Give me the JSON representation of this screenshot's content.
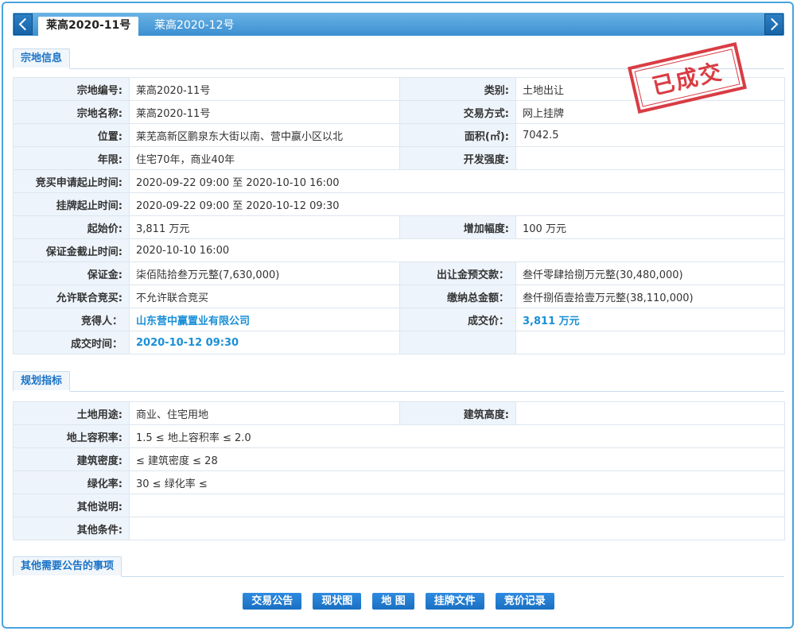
{
  "tabs": {
    "active": "莱高2020-11号",
    "inactive": "莱高2020-12号",
    "prev_icon": "chevron-left-icon",
    "next_icon": "chevron-right-icon"
  },
  "sections": {
    "parcel": "宗地信息",
    "planning": "规划指标",
    "other": "其他需要公告的事项"
  },
  "stamp": "已成交",
  "parcel": {
    "rows": [
      {
        "k1": "宗地编号:",
        "v1": "莱高2020-11号",
        "k2": "类别:",
        "v2": "土地出让"
      },
      {
        "k1": "宗地名称:",
        "v1": "莱高2020-11号",
        "k2": "交易方式:",
        "v2": "网上挂牌"
      },
      {
        "k1": "位置:",
        "v1": "莱芜高新区鹏泉东大街以南、营中嬴小区以北",
        "k2": "面积(㎡):",
        "v2": "7042.5"
      },
      {
        "k1": "年限:",
        "v1": "住宅70年，商业40年",
        "k2": "开发强度:",
        "v2": ""
      },
      {
        "k1": "竞买申请起止时间:",
        "v1": "2020-09-22 09:00 至 2020-10-10 16:00"
      },
      {
        "k1": "挂牌起止时间:",
        "v1": "2020-09-22 09:00 至 2020-10-12 09:30"
      },
      {
        "k1": "起始价:",
        "v1": "3,811 万元",
        "k2": "增加幅度:",
        "v2": "100 万元"
      },
      {
        "k1": "保证金截止时间:",
        "v1": "2020-10-10 16:00"
      },
      {
        "k1": "保证金:",
        "v1": "柒佰陆拾叁万元整(7,630,000)",
        "k2": "出让金预交款：",
        "v2": "叁仟零肆拾捌万元整(30,480,000)"
      },
      {
        "k1": "允许联合竞买:",
        "v1": "不允许联合竞买",
        "k2": "缴纳总金额：",
        "v2": "叁仟捌佰壹拾壹万元整(38,110,000)"
      },
      {
        "k1": "竞得人：",
        "v1": "山东营中赢置业有限公司",
        "k2": "成交价：",
        "v2": "3,811 万元"
      },
      {
        "k1": "成交时间：",
        "v1": "2020-10-12 09:30",
        "k2": "",
        "v2": ""
      }
    ]
  },
  "planning": {
    "rows": [
      {
        "k1": "土地用途:",
        "v1": "商业、住宅用地",
        "k2": "建筑高度:",
        "v2": ""
      },
      {
        "k1": "地上容积率:",
        "v1": "1.5 ≤ 地上容积率 ≤ 2.0"
      },
      {
        "k1": "建筑密度:",
        "v1": "≤ 建筑密度 ≤ 28"
      },
      {
        "k1": "绿化率:",
        "v1": "30 ≤ 绿化率 ≤"
      },
      {
        "k1": "其他说明:",
        "v1": ""
      },
      {
        "k1": "其他条件:",
        "v1": ""
      }
    ]
  },
  "buttons": [
    "交易公告",
    "现状图",
    "地 图",
    "挂牌文件",
    "竞价记录"
  ],
  "colors": {
    "accent": "#1a73c6",
    "highlight": "#1a8fd6",
    "stamp": "#d4232b"
  }
}
